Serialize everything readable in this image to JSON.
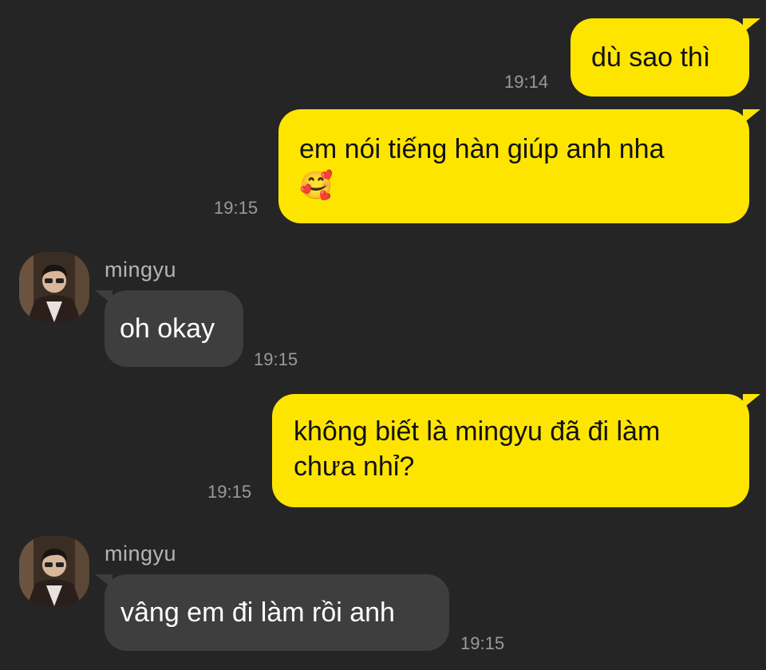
{
  "messages": [
    {
      "dir": "out",
      "text": "dù sao thì",
      "time": "19:14"
    },
    {
      "dir": "out",
      "text": "em nói tiếng hàn giúp anh nha",
      "emoji": "🥰",
      "emoji_name": "smiling-face-with-hearts-icon",
      "time": "19:15"
    },
    {
      "dir": "in",
      "sender": "mingyu",
      "text": "oh okay",
      "time": "19:15"
    },
    {
      "dir": "out",
      "line1": "không biết là mingyu đã đi làm",
      "line2": "chưa nhỉ?",
      "time": "19:15"
    },
    {
      "dir": "in",
      "sender": "mingyu",
      "text": "vâng em đi làm rồi anh",
      "time": "19:15"
    }
  ],
  "colors": {
    "background": "#252525",
    "outgoing_bubble": "#FEE500",
    "incoming_bubble": "#3E3E3E",
    "timestamp": "#9A9A9A",
    "sender_name": "#B5B5B5"
  }
}
